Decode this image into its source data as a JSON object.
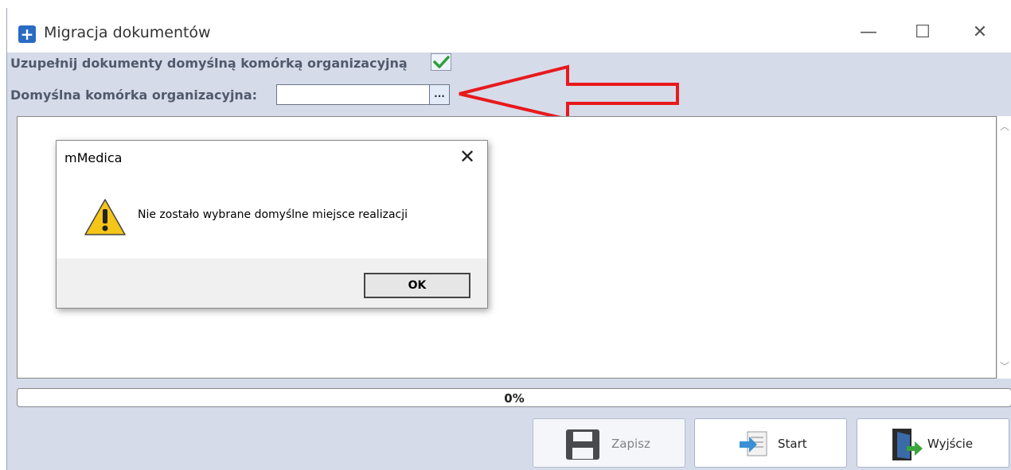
{
  "window": {
    "title": "Migracja dokumentów",
    "icon": "plus-app-icon",
    "controls": {
      "minimize": "—",
      "maximize": "☐",
      "close": "✕"
    }
  },
  "form": {
    "fill_default_label": "Uzupełnij dokumenty domyślną komórką organizacyjną",
    "fill_default_checked": true,
    "default_unit_label": "Domyślna komórka organizacyjna:",
    "default_unit_value": "",
    "browse_button_label": "..."
  },
  "progress": {
    "text": "0%",
    "value": 0
  },
  "buttons": {
    "save_label": "Zapisz",
    "start_label": "Start",
    "exit_label": "Wyjście"
  },
  "dialog": {
    "title": "mMedica",
    "message": "Nie zostało wybrane domyślne miejsce realizacji",
    "ok_label": "OK",
    "close_glyph": "✕",
    "icon": "warning-icon"
  },
  "colors": {
    "accent_red_arrow": "#e8191b",
    "window_bg": "#d6dbe9",
    "check_green": "#2f9e3a"
  }
}
